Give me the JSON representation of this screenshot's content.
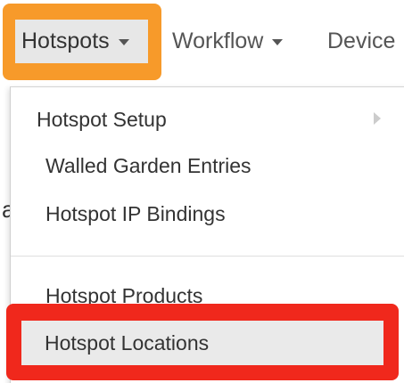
{
  "nav": {
    "items": [
      {
        "label": "Hotspots",
        "active": true
      },
      {
        "label": "Workflow",
        "active": false
      },
      {
        "label": "Device",
        "active": false
      }
    ]
  },
  "dropdown": {
    "items": [
      {
        "label": "Hotspot Setup",
        "has_submenu": true
      },
      {
        "label": "Walled Garden Entries"
      },
      {
        "label": "Hotspot IP Bindings"
      },
      {
        "label": "Hotspot Products"
      },
      {
        "label": "Hotspot Locations",
        "highlighted": true
      }
    ]
  },
  "background": {
    "fragment_text": "a"
  },
  "colors": {
    "highlight_orange": "#f79a2a",
    "highlight_red": "#f0281c",
    "active_tab_bg": "#e7e7e7",
    "text": "#333333",
    "nav_text": "#555555"
  }
}
